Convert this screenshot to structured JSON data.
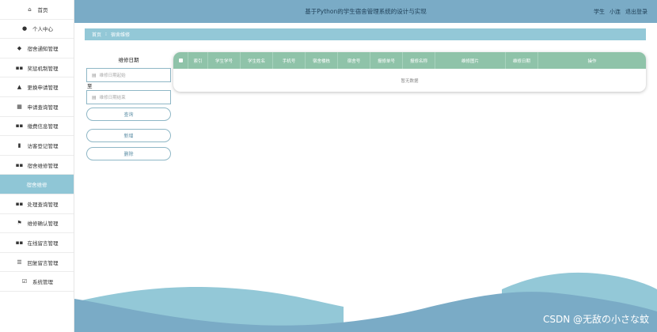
{
  "header": {
    "title": "基于Python的学生宿舍管理系统的设计与实现",
    "user_role": "学生",
    "user_name": "小连",
    "logout_label": "退出登录"
  },
  "sidebar": {
    "items": [
      {
        "label": "首页",
        "icon": "home-icon"
      },
      {
        "label": "个人中心",
        "icon": "user-icon"
      },
      {
        "label": "宿舍通知管理",
        "icon": "tag-icon"
      },
      {
        "label": "奖惩机制管理",
        "icon": "grid-icon"
      },
      {
        "label": "更换申请管理",
        "icon": "thumb-icon"
      },
      {
        "label": "申请查询管理",
        "icon": "table-icon"
      },
      {
        "label": "缴费信息管理",
        "icon": "grid-icon"
      },
      {
        "label": "访客登记管理",
        "icon": "clipboard-icon"
      },
      {
        "label": "宿舍维修管理",
        "icon": "grid-icon"
      },
      {
        "label": "宿舍维修",
        "icon": ""
      },
      {
        "label": "处理查询管理",
        "icon": "grid-icon"
      },
      {
        "label": "维修确认管理",
        "icon": "flag-icon"
      },
      {
        "label": "在线留言管理",
        "icon": "grid-icon"
      },
      {
        "label": "回复留言管理",
        "icon": "list-icon"
      },
      {
        "label": "系统管理",
        "icon": "check-icon"
      }
    ],
    "active_index": 9
  },
  "breadcrumb": {
    "home": "首页",
    "separator": "⁝",
    "current": "宿舍维修"
  },
  "filter": {
    "label": "维修日期",
    "start_placeholder": "维修日期起始",
    "to_label": "至",
    "end_placeholder": "维修日期结束",
    "query_label": "查询",
    "add_label": "新增",
    "delete_label": "删除"
  },
  "table": {
    "columns": [
      "索引",
      "学生学号",
      "学生姓名",
      "手机号",
      "宿舍楼栋",
      "宿舍号",
      "报修单号",
      "报修名称",
      "维修图片",
      "维修日期",
      "操作"
    ],
    "empty_text": "暂无数据"
  },
  "watermark": "CSDN @无敌の小さな蚊",
  "colors": {
    "header": "#7aabc6",
    "sidebar_active": "#8fc6d6",
    "breadcrumb": "#93c8d7",
    "table_header": "#8fc3a9",
    "wave_dark": "#7aabc6",
    "wave_light": "#93c8d7"
  }
}
